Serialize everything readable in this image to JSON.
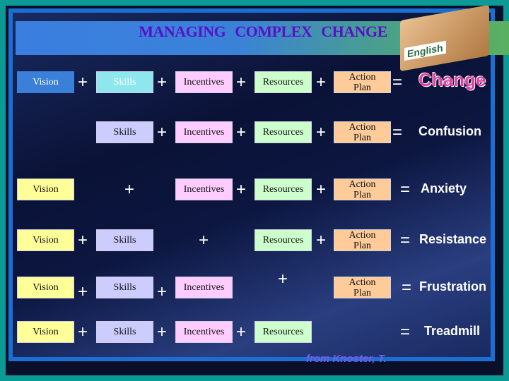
{
  "title": "MANAGING   COMPLEX   CHANGE",
  "logo_text": "English",
  "plus": "+",
  "equals": "=",
  "colors": {
    "vision": "#ffff99",
    "skills": "#ccccff",
    "incentives": "#ffccff",
    "resources": "#ccffcc",
    "action": "#ffcc99",
    "vision_first": "#3a7fd8",
    "skills_first": "#8ee6ee"
  },
  "rows": [
    {
      "terms": [
        "Vision",
        "Skills",
        "Incentives",
        "Resources",
        "Action\nPlan"
      ],
      "result": "Change"
    },
    {
      "terms": [
        null,
        "Skills",
        "Incentives",
        "Resources",
        "Action\nPlan"
      ],
      "result": "Confusion"
    },
    {
      "terms": [
        "Vision",
        null,
        "Incentives",
        "Resources",
        "Action\nPlan"
      ],
      "result": "Anxiety"
    },
    {
      "terms": [
        "Vision",
        "Skills",
        null,
        "Resources",
        "Action\nPlan"
      ],
      "result": "Resistance"
    },
    {
      "terms": [
        "Vision",
        "Skills",
        "Incentives",
        null,
        "Action\nPlan"
      ],
      "result": "Frustration"
    },
    {
      "terms": [
        "Vision",
        "Skills",
        "Incentives",
        "Resources",
        null
      ],
      "result": "Treadmill"
    }
  ],
  "credit": "from Knoster, T."
}
